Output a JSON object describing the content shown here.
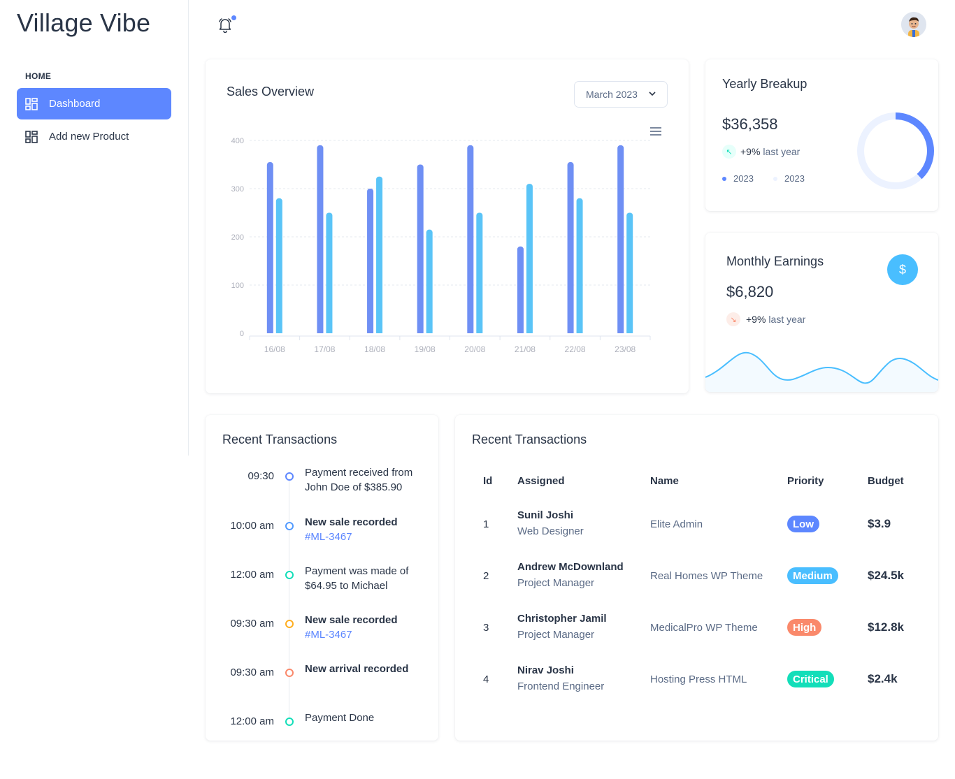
{
  "brand": "Village Vibe",
  "sidebar": {
    "caption": "HOME",
    "items": [
      {
        "label": "Dashboard",
        "active": true,
        "icon": "dashboard-icon"
      },
      {
        "label": "Add new Product",
        "active": false,
        "icon": "dashboard-icon"
      }
    ]
  },
  "header": {
    "notification_icon": "bell-icon",
    "avatar": "user-avatar"
  },
  "sales": {
    "title": "Sales Overview",
    "select_value": "March 2023",
    "menu_icon": "hamburger-menu-icon"
  },
  "chart_data": {
    "type": "bar",
    "categories": [
      "16/08",
      "17/08",
      "18/08",
      "19/08",
      "20/08",
      "21/08",
      "22/08",
      "23/08"
    ],
    "series": [
      {
        "values": [
          355,
          390,
          300,
          350,
          390,
          180,
          355,
          390
        ],
        "color": "#6f8ff4"
      },
      {
        "values": [
          280,
          250,
          325,
          215,
          250,
          310,
          280,
          250
        ],
        "color": "#5ac4f7"
      }
    ],
    "yticks": [
      "0",
      "100",
      "200",
      "300",
      "400"
    ],
    "ylim": [
      0,
      400
    ],
    "grid": true
  },
  "yearly": {
    "title": "Yearly Breakup",
    "amount": "$36,358",
    "delta": "+9%",
    "delta_suffix": "last year",
    "legend": [
      "2023",
      "2023"
    ],
    "donut_fraction": 0.38,
    "colors": {
      "primary": "#5d87ff",
      "light": "#ecf2ff"
    }
  },
  "monthly": {
    "title": "Monthly Earnings",
    "amount": "$6,820",
    "delta": "+9%",
    "delta_suffix": "last year",
    "icon": "dollar-icon"
  },
  "timeline": {
    "title": "Recent Transactions",
    "items": [
      {
        "time": "09:30",
        "text": "Payment received from John Doe of $385.90",
        "bold": false,
        "link": "",
        "color": "#5d87ff"
      },
      {
        "time": "10:00 am",
        "text": "New sale recorded",
        "bold": true,
        "link": "#ML-3467",
        "color": "#539bff"
      },
      {
        "time": "12:00 am",
        "text": "Payment was made of $64.95 to Michael",
        "bold": false,
        "link": "",
        "color": "#13deb9"
      },
      {
        "time": "09:30 am",
        "text": "New sale recorded",
        "bold": true,
        "link": "#ML-3467",
        "color": "#ffae1f"
      },
      {
        "time": "09:30 am",
        "text": "New arrival recorded",
        "bold": true,
        "link": "",
        "color": "#fa896b"
      },
      {
        "time": "12:00 am",
        "text": "Payment Done",
        "bold": false,
        "link": "",
        "color": "#13deb9"
      }
    ]
  },
  "table": {
    "title": "Recent Transactions",
    "headers": [
      "Id",
      "Assigned",
      "Name",
      "Priority",
      "Budget"
    ],
    "rows": [
      {
        "id": "1",
        "name": "Sunil Joshi",
        "role": "Web Designer",
        "project": "Elite Admin",
        "priority": "Low",
        "color": "#5d87ff",
        "budget": "$3.9"
      },
      {
        "id": "2",
        "name": "Andrew McDownland",
        "role": "Project Manager",
        "project": "Real Homes WP Theme",
        "priority": "Medium",
        "color": "#49beff",
        "budget": "$24.5k"
      },
      {
        "id": "3",
        "name": "Christopher Jamil",
        "role": "Project Manager",
        "project": "MedicalPro WP Theme",
        "priority": "High",
        "color": "#fa896b",
        "budget": "$12.8k"
      },
      {
        "id": "4",
        "name": "Nirav Joshi",
        "role": "Frontend Engineer",
        "project": "Hosting Press HTML",
        "priority": "Critical",
        "color": "#13deb9",
        "budget": "$2.4k"
      }
    ]
  }
}
